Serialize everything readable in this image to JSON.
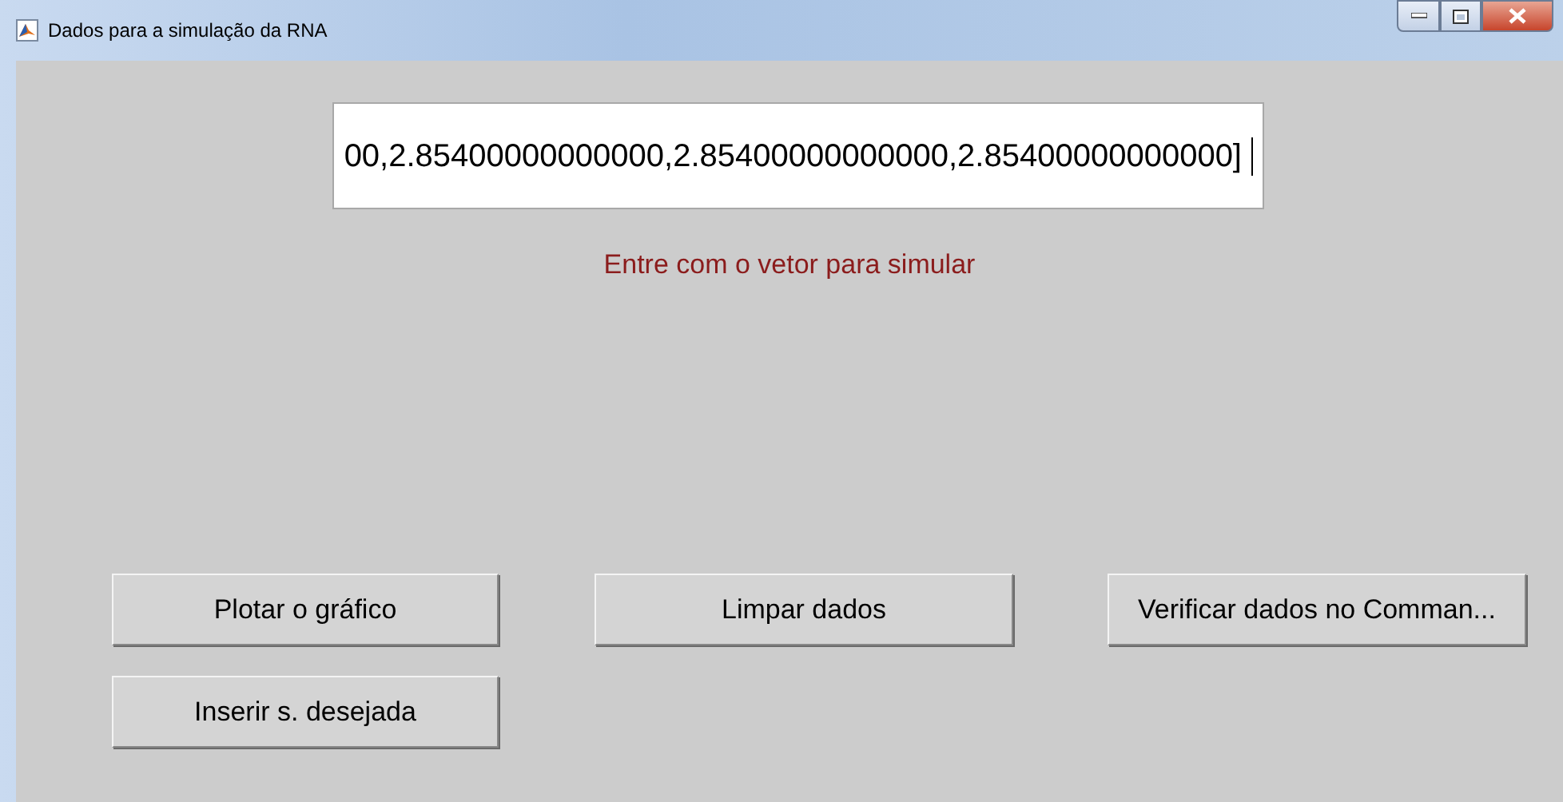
{
  "window": {
    "title": "Dados para a simulação da RNA"
  },
  "vector_field": {
    "value": "00,2.85400000000000,2.85400000000000,2.85400000000000]"
  },
  "prompt": "Entre com o vetor para simular",
  "buttons": [
    {
      "label": "Plotar o gráfico"
    },
    {
      "label": "Limpar dados"
    },
    {
      "label": "Verificar dados no Comman..."
    },
    {
      "label": "Inserir s. desejada"
    }
  ]
}
